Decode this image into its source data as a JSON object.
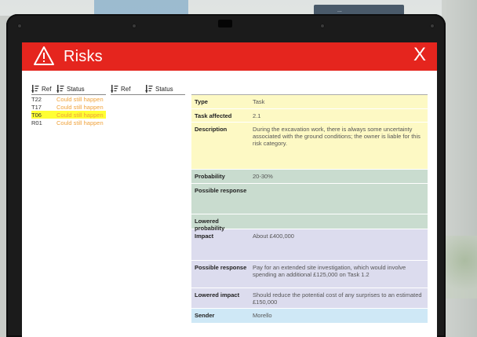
{
  "background": {
    "sign_text": "..."
  },
  "dialog": {
    "title": "Risks",
    "close_label": "X",
    "accent_color": "#e5251e"
  },
  "list_left": {
    "headers": {
      "ref": "Ref",
      "status": "Status"
    },
    "rows": [
      {
        "ref": "T22",
        "status": "Could still happen",
        "selected": false
      },
      {
        "ref": "T17",
        "status": "Could still happen",
        "selected": false
      },
      {
        "ref": "T06",
        "status": "Could still happen",
        "selected": true
      },
      {
        "ref": "R01",
        "status": "Could still happen",
        "selected": false
      }
    ]
  },
  "list_right": {
    "headers": {
      "ref": "Ref",
      "status": "Status"
    },
    "rows": []
  },
  "detail": {
    "type": {
      "label": "Type",
      "value": "Task"
    },
    "task_affected": {
      "label": "Task affected",
      "value": "2.1"
    },
    "description": {
      "label": "Description",
      "value": "During the excavation work, there is always some uncertainty associated with the ground conditions; the owner is liable for this risk category."
    },
    "probability": {
      "label": "Probability",
      "value": "20-30%"
    },
    "possible_response_1": {
      "label": "Possible response",
      "value": ""
    },
    "lowered_probability": {
      "label": "Lowered probability",
      "value": ""
    },
    "impact": {
      "label": "Impact",
      "value": "About £400,000"
    },
    "possible_response_2": {
      "label": "Possible response",
      "value": "Pay for an extended site investigation, which would involve spending an additional £125,000 on Task 1.2"
    },
    "lowered_impact": {
      "label": "Lowered impact",
      "value": "Should reduce the potential cost of any surprises to an estimated £150,000"
    },
    "sender": {
      "label": "Sender",
      "value": "Morello"
    }
  },
  "colors": {
    "status_text": "#f0a23a",
    "selected_row": "#ffff33",
    "yellow_section": "#fdf9c4",
    "green_section": "#c9dccf",
    "lavender_section": "#dcdcee",
    "blue_section": "#cfe8f6"
  }
}
